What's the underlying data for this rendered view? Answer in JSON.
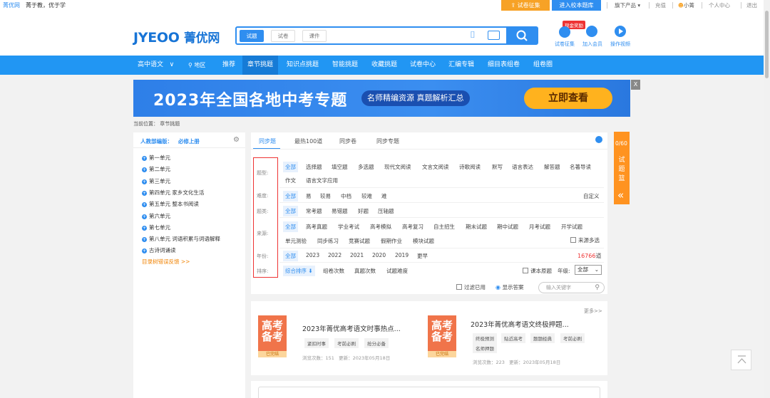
{
  "topbar": {
    "brand": "菁优网",
    "slogan": "菁于教，优于学",
    "exam_collect": "试卷征集",
    "enter_bank": "进入校本题库",
    "flagship": "旗下产品",
    "recharge": "充值",
    "username": "小菁",
    "personal_center": "个人中心",
    "logout": "退出"
  },
  "header": {
    "logo_en": "JYEOO",
    "logo_cn": "菁优网",
    "search_tabs": [
      "试题",
      "试卷",
      "课件"
    ],
    "cash_reward_badge": "现金奖励",
    "icons": [
      {
        "label": "试卷征集",
        "icon": "upload-icon"
      },
      {
        "label": "加入会员",
        "icon": "diamond-icon"
      },
      {
        "label": "操作视频",
        "icon": "play-icon"
      }
    ]
  },
  "nav": {
    "subject": "高中语文",
    "region": "地区",
    "items": [
      "推荐",
      "章节挑题",
      "知识点挑题",
      "智能挑题",
      "收藏挑题",
      "试卷中心",
      "汇编专辑",
      "细目表组卷",
      "组卷圈"
    ],
    "active": "章节挑题"
  },
  "banner": {
    "title": "2023年全国各地中考专题",
    "pill": "名师精编资源  真题解析汇总",
    "cta": "立即查看",
    "close": "X"
  },
  "breadcrumb": {
    "label": "当前位置：",
    "current": "章节挑题"
  },
  "left": {
    "edition": "人教部编版：",
    "book": "必修上册",
    "units": [
      "第一单元",
      "第二单元",
      "第三单元",
      "第四单元 家乡文化生活",
      "第五单元 整本书阅读",
      "第六单元",
      "第七单元",
      "第八单元 词语积累与词语解释",
      "古诗词诵读"
    ],
    "feedback": "目录树错误反馈 >>"
  },
  "main": {
    "tabs": [
      "同步题",
      "最热100道",
      "同步卷",
      "同步专题"
    ],
    "rows": [
      {
        "label": "题型:",
        "options": [
          "全部",
          "选择题",
          "填空题",
          "多选题",
          "现代文阅读",
          "文言文阅读",
          "诗歌阅读",
          "默写",
          "语言表达",
          "解答题",
          "名著导读",
          "作文",
          "语言文字应用"
        ]
      },
      {
        "label": "难度:",
        "options": [
          "全部",
          "易",
          "较易",
          "中档",
          "较难",
          "难"
        ],
        "extra": "自定义"
      },
      {
        "label": "题类:",
        "options": [
          "全部",
          "常考题",
          "易错题",
          "好题",
          "压轴题"
        ]
      },
      {
        "label": "来源:",
        "options": [
          "全部",
          "高考真题",
          "学业考试",
          "高考模拟",
          "高考复习",
          "自主招生",
          "期末试题",
          "期中试题",
          "月考试题",
          "开学试题",
          "单元测验",
          "同步练习",
          "竞赛试题",
          "假期作业",
          "模块试题"
        ],
        "extra": "来源多选"
      },
      {
        "label": "年份:",
        "options": [
          "全部",
          "2023",
          "2022",
          "2021",
          "2020",
          "2019",
          "更早"
        ],
        "count": "16766",
        "count_unit": "道"
      },
      {
        "label": "排序:",
        "options": [
          "综合排序",
          "组卷次数",
          "真题次数",
          "试题难度"
        ],
        "course_original": "课本原题",
        "grade_label": "年级:",
        "grade_value": "全部"
      }
    ],
    "filter_used": "过滤已用",
    "show_answer": "显示答案",
    "keyword_placeholder": "输入关键字"
  },
  "cards": {
    "more": "更多>>",
    "items": [
      {
        "cover": "高考备考",
        "stamp": "已完结",
        "title": "2023年菁优高考语文时事热点...",
        "tags": [
          "紧扣时事",
          "考前必刷",
          "抢分必备"
        ],
        "views_label": "浏览次数：",
        "views": "151",
        "updated_label": "更新：",
        "updated": "2023年05月18日"
      },
      {
        "cover": "高考备考",
        "stamp": "已完结",
        "title": "2023年菁优高考语文终极押题...",
        "tags": [
          "终极预测",
          "贴近高考",
          "题题经典",
          "考前必刷",
          "名师押题"
        ],
        "views_label": "浏览次数：",
        "views": "223",
        "updated_label": "更新：",
        "updated": "2023年05月18日"
      }
    ]
  },
  "side": {
    "count": "0/60",
    "label": "试题篮",
    "arrow": "«"
  }
}
